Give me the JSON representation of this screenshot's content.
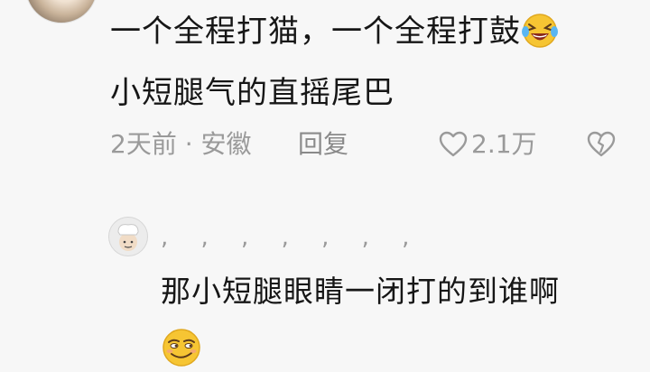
{
  "comment": {
    "line1": "一个全程打猫，一个全程打鼓",
    "line1_emoji": "laughing-tears-emoji",
    "line2": "小短腿气的直摇尾巴",
    "time_location": "2天前 · 安徽",
    "reply_label": "回复",
    "likes": "2.1万",
    "like_icon": "heart-outline-icon",
    "dislike_icon": "broken-heart-icon"
  },
  "reply": {
    "username": ", , , , , , ,",
    "text": "那小短腿眼睛一闭打的到谁啊",
    "emoji": "smirk-emoji"
  },
  "colors": {
    "background": "#f7f7f7",
    "text": "#161616",
    "meta": "#9a9a9a",
    "emoji_yellow": "#f6c533"
  }
}
